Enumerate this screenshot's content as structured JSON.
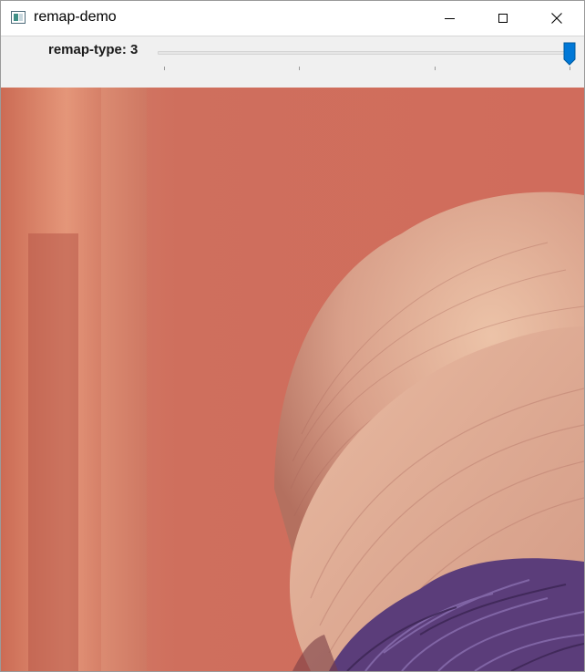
{
  "window": {
    "title": "remap-demo",
    "icon": "app-window-icon",
    "controls": [
      "minimize-icon",
      "maximize-icon",
      "close-icon"
    ]
  },
  "trackbar": {
    "name": "remap-type",
    "label": "remap-type: 3",
    "value": 3,
    "min": 0,
    "max": 3,
    "ticks": [
      0,
      1,
      2,
      3
    ],
    "accent_color": "#0078d7"
  },
  "image": {
    "colors": {
      "background": "#d06f5d",
      "hat": "#e6b39a",
      "feather": "#5b3d7a"
    }
  }
}
